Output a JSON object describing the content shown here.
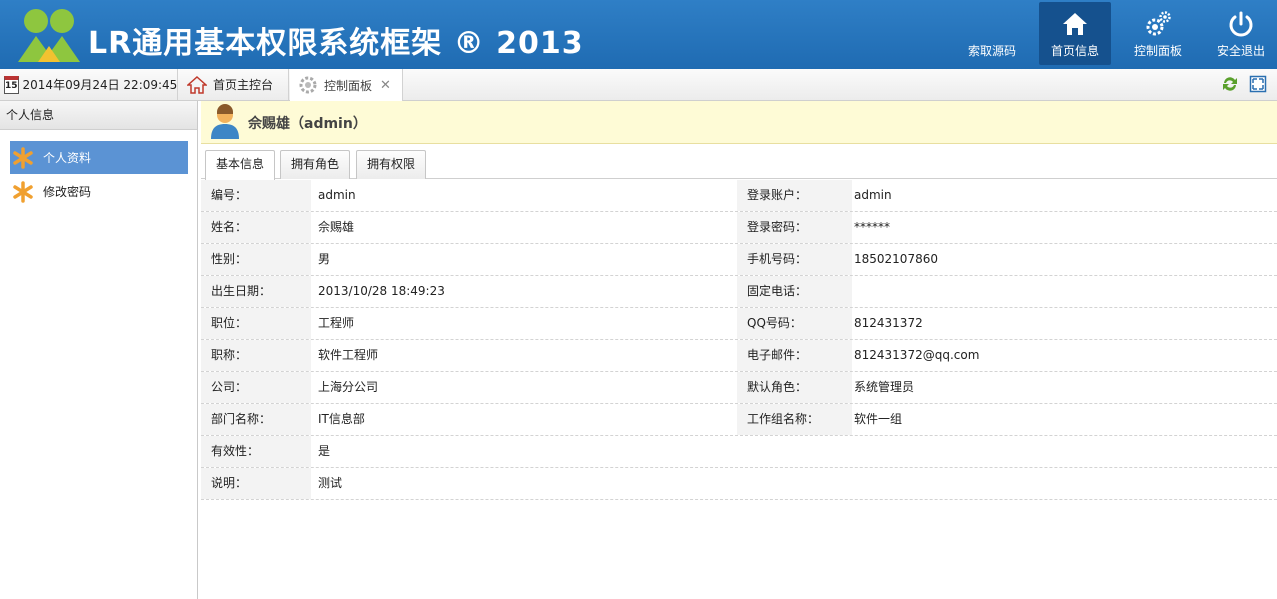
{
  "app": {
    "title": "LR通用基本权限系统框架 ® 2013",
    "logo_icon": "two-users-logo"
  },
  "nav": [
    {
      "label": "索取源码",
      "icon": "",
      "active": false
    },
    {
      "label": "首页信息",
      "icon": "home-icon",
      "active": true
    },
    {
      "label": "控制面板",
      "icon": "gears-icon",
      "active": false
    },
    {
      "label": "安全退出",
      "icon": "power-icon",
      "active": false
    }
  ],
  "toolbar": {
    "calendar_day": "15",
    "datetime": "2014年09月24日 22:09:45",
    "tabs": [
      {
        "label": "首页主控台",
        "icon": "house-icon",
        "closable": false
      },
      {
        "label": "控制面板",
        "icon": "gear-icon",
        "closable": true
      }
    ],
    "right_icons": [
      "refresh-icon",
      "fullscreen-icon"
    ]
  },
  "sidebar": {
    "header": "个人信息",
    "items": [
      {
        "label": "个人资料",
        "active": true
      },
      {
        "label": "修改密码",
        "active": false
      }
    ]
  },
  "user": {
    "display": "佘赐雄（admin）"
  },
  "subtabs": [
    "基本信息",
    "拥有角色",
    "拥有权限"
  ],
  "fields": [
    {
      "l1": "编号：",
      "v1": "admin",
      "l2": "登录账户：",
      "v2": "admin"
    },
    {
      "l1": "姓名：",
      "v1": "佘赐雄",
      "l2": "登录密码：",
      "v2": "******"
    },
    {
      "l1": "性别：",
      "v1": "男",
      "l2": "手机号码：",
      "v2": "18502107860"
    },
    {
      "l1": "出生日期：",
      "v1": "2013/10/28 18:49:23",
      "l2": "固定电话：",
      "v2": ""
    },
    {
      "l1": "职位：",
      "v1": "工程师",
      "l2": "QQ号码：",
      "v2": "812431372"
    },
    {
      "l1": "职称：",
      "v1": "软件工程师",
      "l2": "电子邮件：",
      "v2": "812431372@qq.com"
    },
    {
      "l1": "公司：",
      "v1": "上海分公司",
      "l2": "默认角色：",
      "v2": "系统管理员"
    },
    {
      "l1": "部门名称：",
      "v1": "IT信息部",
      "l2": "工作组名称：",
      "v2": "软件一组"
    },
    {
      "l1": "有效性：",
      "v1": "是"
    },
    {
      "l1": "说明：",
      "v1": "测试"
    }
  ],
  "colors": {
    "header_blue": "#1f6bb2",
    "nav_active": "#15518e",
    "sidebar_active": "#5b93d4",
    "banner_yellow": "#fefbd6"
  }
}
